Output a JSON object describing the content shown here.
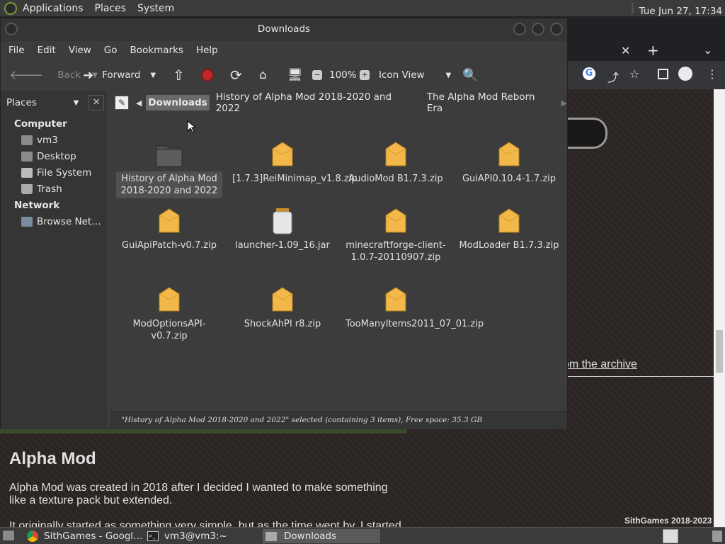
{
  "topbar": {
    "menus": [
      "Applications",
      "Places",
      "System"
    ],
    "clock": "Tue Jun 27, 17:34"
  },
  "browser": {
    "heading": "Alpha Mod",
    "para1_line1": "Alpha Mod was created in 2018 after I decided I wanted to make something",
    "para1_line2": "like a texture pack but extended.",
    "para2_partial": "It originally started as something very simple, but as the time went by, I started",
    "archive_link": "om the archive",
    "footer": "SithGames 2018-2023"
  },
  "file_manager": {
    "title": "Downloads",
    "menu": [
      "File",
      "Edit",
      "View",
      "Go",
      "Bookmarks",
      "Help"
    ],
    "toolbar": {
      "back": "Back",
      "forward": "Forward",
      "zoom": "100%",
      "view_mode": "Icon View"
    },
    "sidebar": {
      "header": "Places",
      "groups": [
        {
          "title": "Computer",
          "items": [
            "vm3",
            "Desktop",
            "File System",
            "Trash"
          ]
        },
        {
          "title": "Network",
          "items": [
            "Browse Net…"
          ]
        }
      ]
    },
    "breadcrumbs": [
      "Downloads",
      "History of Alpha Mod 2018-2020 and 2022",
      "The Alpha Mod Reborn Era"
    ],
    "files": [
      {
        "name": "History of Alpha Mod 2018-2020 and 2022",
        "type": "folder",
        "selected": true
      },
      {
        "name": "[1.7.3]ReiMinimap_v1.8.zip",
        "type": "zip"
      },
      {
        "name": "AudioMod B1.7.3.zip",
        "type": "zip"
      },
      {
        "name": "GuiAPI0.10.4-1.7.zip",
        "type": "zip"
      },
      {
        "name": "GuiApiPatch-v0.7.zip",
        "type": "zip"
      },
      {
        "name": "launcher-1.09_16.jar",
        "type": "jar"
      },
      {
        "name": "minecraftforge-client-1.0.7-20110907.zip",
        "type": "zip"
      },
      {
        "name": "ModLoader B1.7.3.zip",
        "type": "zip"
      },
      {
        "name": "ModOptionsAPI-v0.7.zip",
        "type": "zip"
      },
      {
        "name": "ShockAhPI r8.zip",
        "type": "zip"
      },
      {
        "name": "TooManyItems2011_07_01.zip",
        "type": "zip"
      }
    ],
    "status": "\"History of Alpha Mod 2018-2020 and 2022\" selected (containing 3 items), Free space: 35.3 GB"
  },
  "taskbar": {
    "tasks": [
      "SithGames - Googl…",
      "vm3@vm3:~",
      "Downloads"
    ]
  }
}
